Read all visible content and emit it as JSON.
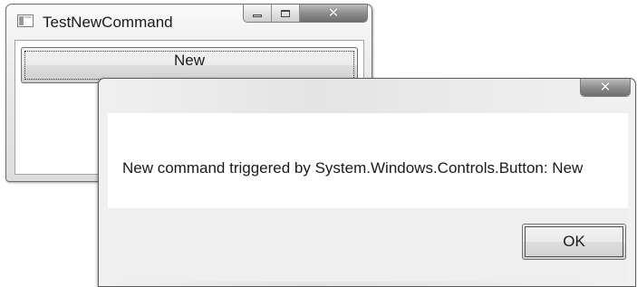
{
  "main_window": {
    "title": "TestNewCommand",
    "icon": "window-app-icon",
    "caption_buttons": [
      "minimize-icon",
      "maximize-icon",
      "close-icon"
    ],
    "button_label": "New"
  },
  "message_box": {
    "caption_buttons": [
      "close-icon"
    ],
    "message": "New command triggered by System.Windows.Controls.Button: New",
    "ok_label": "OK"
  }
}
